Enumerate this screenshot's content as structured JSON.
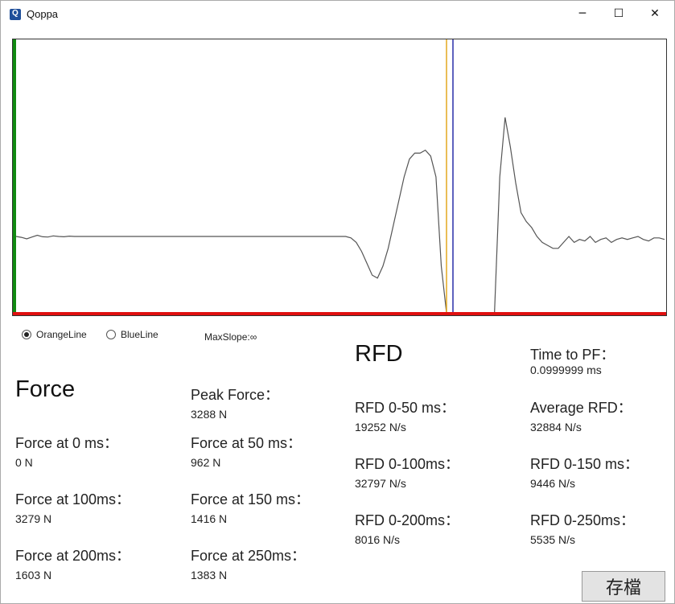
{
  "window": {
    "title": "Qoppa",
    "minimize_glyph": "─",
    "maximize_glyph": "☐",
    "close_glyph": "✕"
  },
  "chart_data": {
    "type": "line",
    "title": "",
    "xlabel": "",
    "ylabel": "",
    "series": [
      {
        "values": [
          0,
          -0.3,
          -0.8,
          -0.2,
          0.4,
          -0.1,
          -0.2,
          0.2,
          0,
          -0.1,
          0.1,
          0,
          0,
          0,
          0,
          0,
          0,
          0,
          0,
          0,
          0,
          0,
          0,
          0,
          0,
          0,
          0,
          0,
          0,
          0,
          0,
          0,
          0,
          0,
          0,
          0,
          0,
          0,
          0,
          0,
          0,
          0,
          0,
          0,
          0,
          0,
          0,
          0,
          0,
          0,
          0,
          0,
          0,
          0,
          0,
          0,
          0,
          0,
          0,
          0,
          0,
          0,
          0,
          -0.5,
          -2,
          -5,
          -9,
          -13,
          -14,
          -10,
          -4,
          4,
          12,
          20,
          26,
          28,
          28,
          29,
          27,
          20,
          -10,
          -60,
          -90,
          -95,
          -95,
          -90,
          -95,
          -95,
          -95,
          -95,
          -60,
          20,
          40,
          30,
          18,
          8,
          5,
          3,
          0,
          -2,
          -3,
          -4,
          -4,
          -2,
          0,
          -2,
          -1,
          -1.5,
          0,
          -2,
          -1,
          -0.5,
          -2,
          -1,
          -0.5,
          -1,
          -0.5,
          0,
          -1,
          -1.5,
          -0.5,
          -0.5,
          -1
        ]
      }
    ],
    "markers": {
      "orange_line": "#e3a91e",
      "blue_line": "#2a2ea8",
      "left_axis": "#118a11",
      "bottom_axis": "#e01010",
      "trace": "#555555"
    },
    "grid": false
  },
  "controls": {
    "radio_orange": "OrangeLine",
    "radio_blue": "BlueLine",
    "selected": "OrangeLine",
    "max_slope": "MaxSlope:∞"
  },
  "force": {
    "heading": "Force",
    "peak_label": "Peak Force：",
    "peak_value": "3288 N",
    "f0_label": "Force at 0 ms：",
    "f0_value": "0 N",
    "f50_label": "Force at 50 ms：",
    "f50_value": "962 N",
    "f100_label": "Force at 100ms：",
    "f100_value": "3279 N",
    "f150_label": "Force at 150 ms：",
    "f150_value": "1416 N",
    "f200_label": "Force at 200ms：",
    "f200_value": "1603 N",
    "f250_label": "Force at 250ms：",
    "f250_value": "1383 N"
  },
  "rfd": {
    "heading": "RFD",
    "ttpf_label": "Time to PF：",
    "ttpf_value": "0.0999999 ms",
    "r50_label": "RFD 0-50 ms：",
    "r50_value": "19252 N/s",
    "avg_label": "Average RFD：",
    "avg_value": "32884 N/s",
    "r100_label": "RFD 0-100ms：",
    "r100_value": "32797 N/s",
    "r150_label": "RFD 0-150 ms：",
    "r150_value": "9446 N/s",
    "r200_label": "RFD 0-200ms：",
    "r200_value": "8016 N/s",
    "r250_label": "RFD 0-250ms：",
    "r250_value": "5535 N/s"
  },
  "save_button": "存檔"
}
